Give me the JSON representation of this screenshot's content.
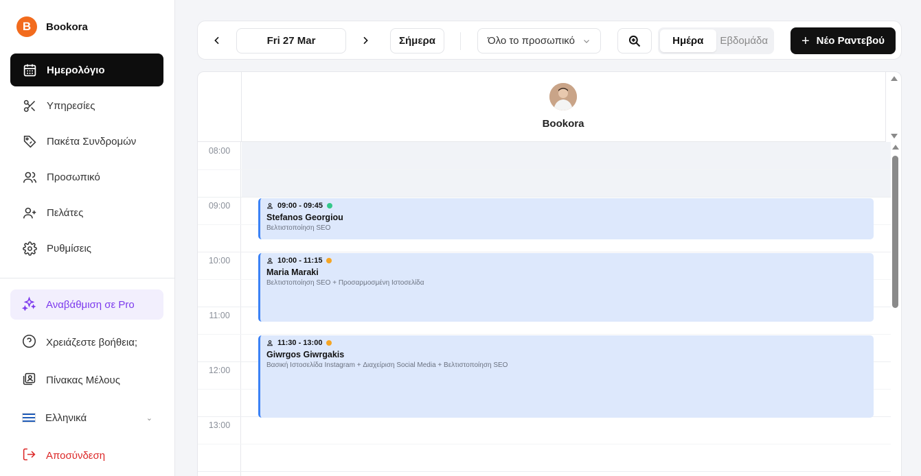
{
  "brand": {
    "logo_letter": "B",
    "name": "Bookora"
  },
  "nav": [
    {
      "label": "Ημερολόγιο",
      "icon": "calendar-icon",
      "active": true
    },
    {
      "label": "Υπηρεσίες",
      "icon": "scissors-icon"
    },
    {
      "label": "Πακέτα Συνδρομών",
      "icon": "tag-icon"
    },
    {
      "label": "Προσωπικό",
      "icon": "users-icon"
    },
    {
      "label": "Πελάτες",
      "icon": "user-plus-icon"
    },
    {
      "label": "Ρυθμίσεις",
      "icon": "gear-icon"
    }
  ],
  "bottom_nav": {
    "upgrade": "Αναβάθμιση σε Pro",
    "help": "Χρειάζεστε βοήθεια;",
    "member_board": "Πίνακας Μέλους",
    "language": "Ελληνικά",
    "logout": "Αποσύνδεση"
  },
  "toolbar": {
    "date": "Fri 27 Mar",
    "today": "Σήμερα",
    "staff_filter": "Όλο το προσωπικό",
    "view_day": "Ημέρα",
    "view_week": "Εβδομάδα",
    "new_appointment": "Νέο Ραντεβού"
  },
  "calendar": {
    "staff_name": "Bookora",
    "hours": [
      "08:00",
      "09:00",
      "10:00",
      "11:00",
      "12:00",
      "13:00"
    ],
    "appointments": [
      {
        "time": "09:00 - 09:45",
        "status_color": "#34c88a",
        "client": "Stefanos Georgiou",
        "service": "Βελτιστοποίηση SEO"
      },
      {
        "time": "10:00 - 11:15",
        "status_color": "#f5a524",
        "client": "Maria Maraki",
        "service": "Βελτιστοποίηση SEO + Προσαρμοσμένη Ιστοσελίδα"
      },
      {
        "time": "11:30 - 13:00",
        "status_color": "#f5a524",
        "client": "Giwrgos Giwrgakis",
        "service": "Βασική Ιστοσελίδα Instagram + Διαχείριση Social Media + Βελτιστοποίηση SEO"
      }
    ]
  },
  "colors": {
    "accent": "#f26b1d",
    "pro": "#7c3aed",
    "logout": "#dc2626",
    "appointment_bg": "#dde8fc",
    "appointment_border": "#3b82f6"
  }
}
